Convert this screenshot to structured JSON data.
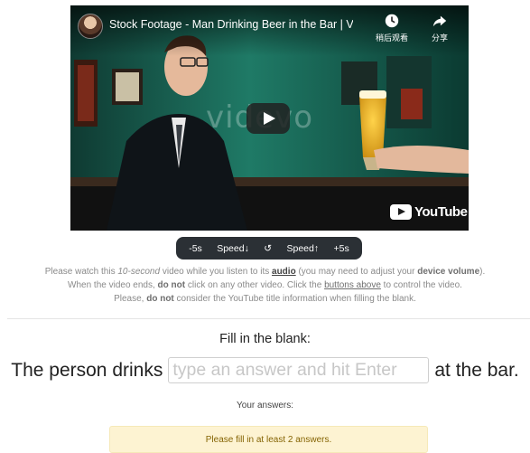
{
  "video": {
    "title": "Stock Footage - Man Drinking Beer in the Bar | Vide...",
    "watch_later_label": "稍后观看",
    "share_label": "分享",
    "watermark": "videvo",
    "logo_text": "YouTube"
  },
  "controls": {
    "back_label": "-5s",
    "speed_down_label": "Speed↓",
    "replay_label": "↺",
    "speed_up_label": "Speed↑",
    "forward_label": "+5s"
  },
  "instructions": {
    "l1_a": "Please watch this ",
    "l1_em": "10-second",
    "l1_b": " video while you listen to its ",
    "l1_audio": "audio",
    "l1_c": " (you may need to adjust your ",
    "l1_vol": "device volume",
    "l1_d": ").",
    "l2_a": "When the video ends, ",
    "l2_not": "do not",
    "l2_b": " click on any other video. Click the ",
    "l2_btns": "buttons above",
    "l2_c": " to control the video.",
    "l3_a": "Please, ",
    "l3_not": "do not",
    "l3_b": " consider the YouTube title information when filling the blank."
  },
  "task": {
    "heading": "Fill in the blank:",
    "before": "The person drinks",
    "placeholder": "type an answer and hit Enter",
    "after": "at the bar."
  },
  "answers": {
    "label": "Your answers:",
    "alert": "Please fill in at least 2 answers."
  },
  "colors": {
    "alert_bg": "#fdf3d2",
    "alert_text": "#856404",
    "controls_bg": "#2b3035"
  }
}
